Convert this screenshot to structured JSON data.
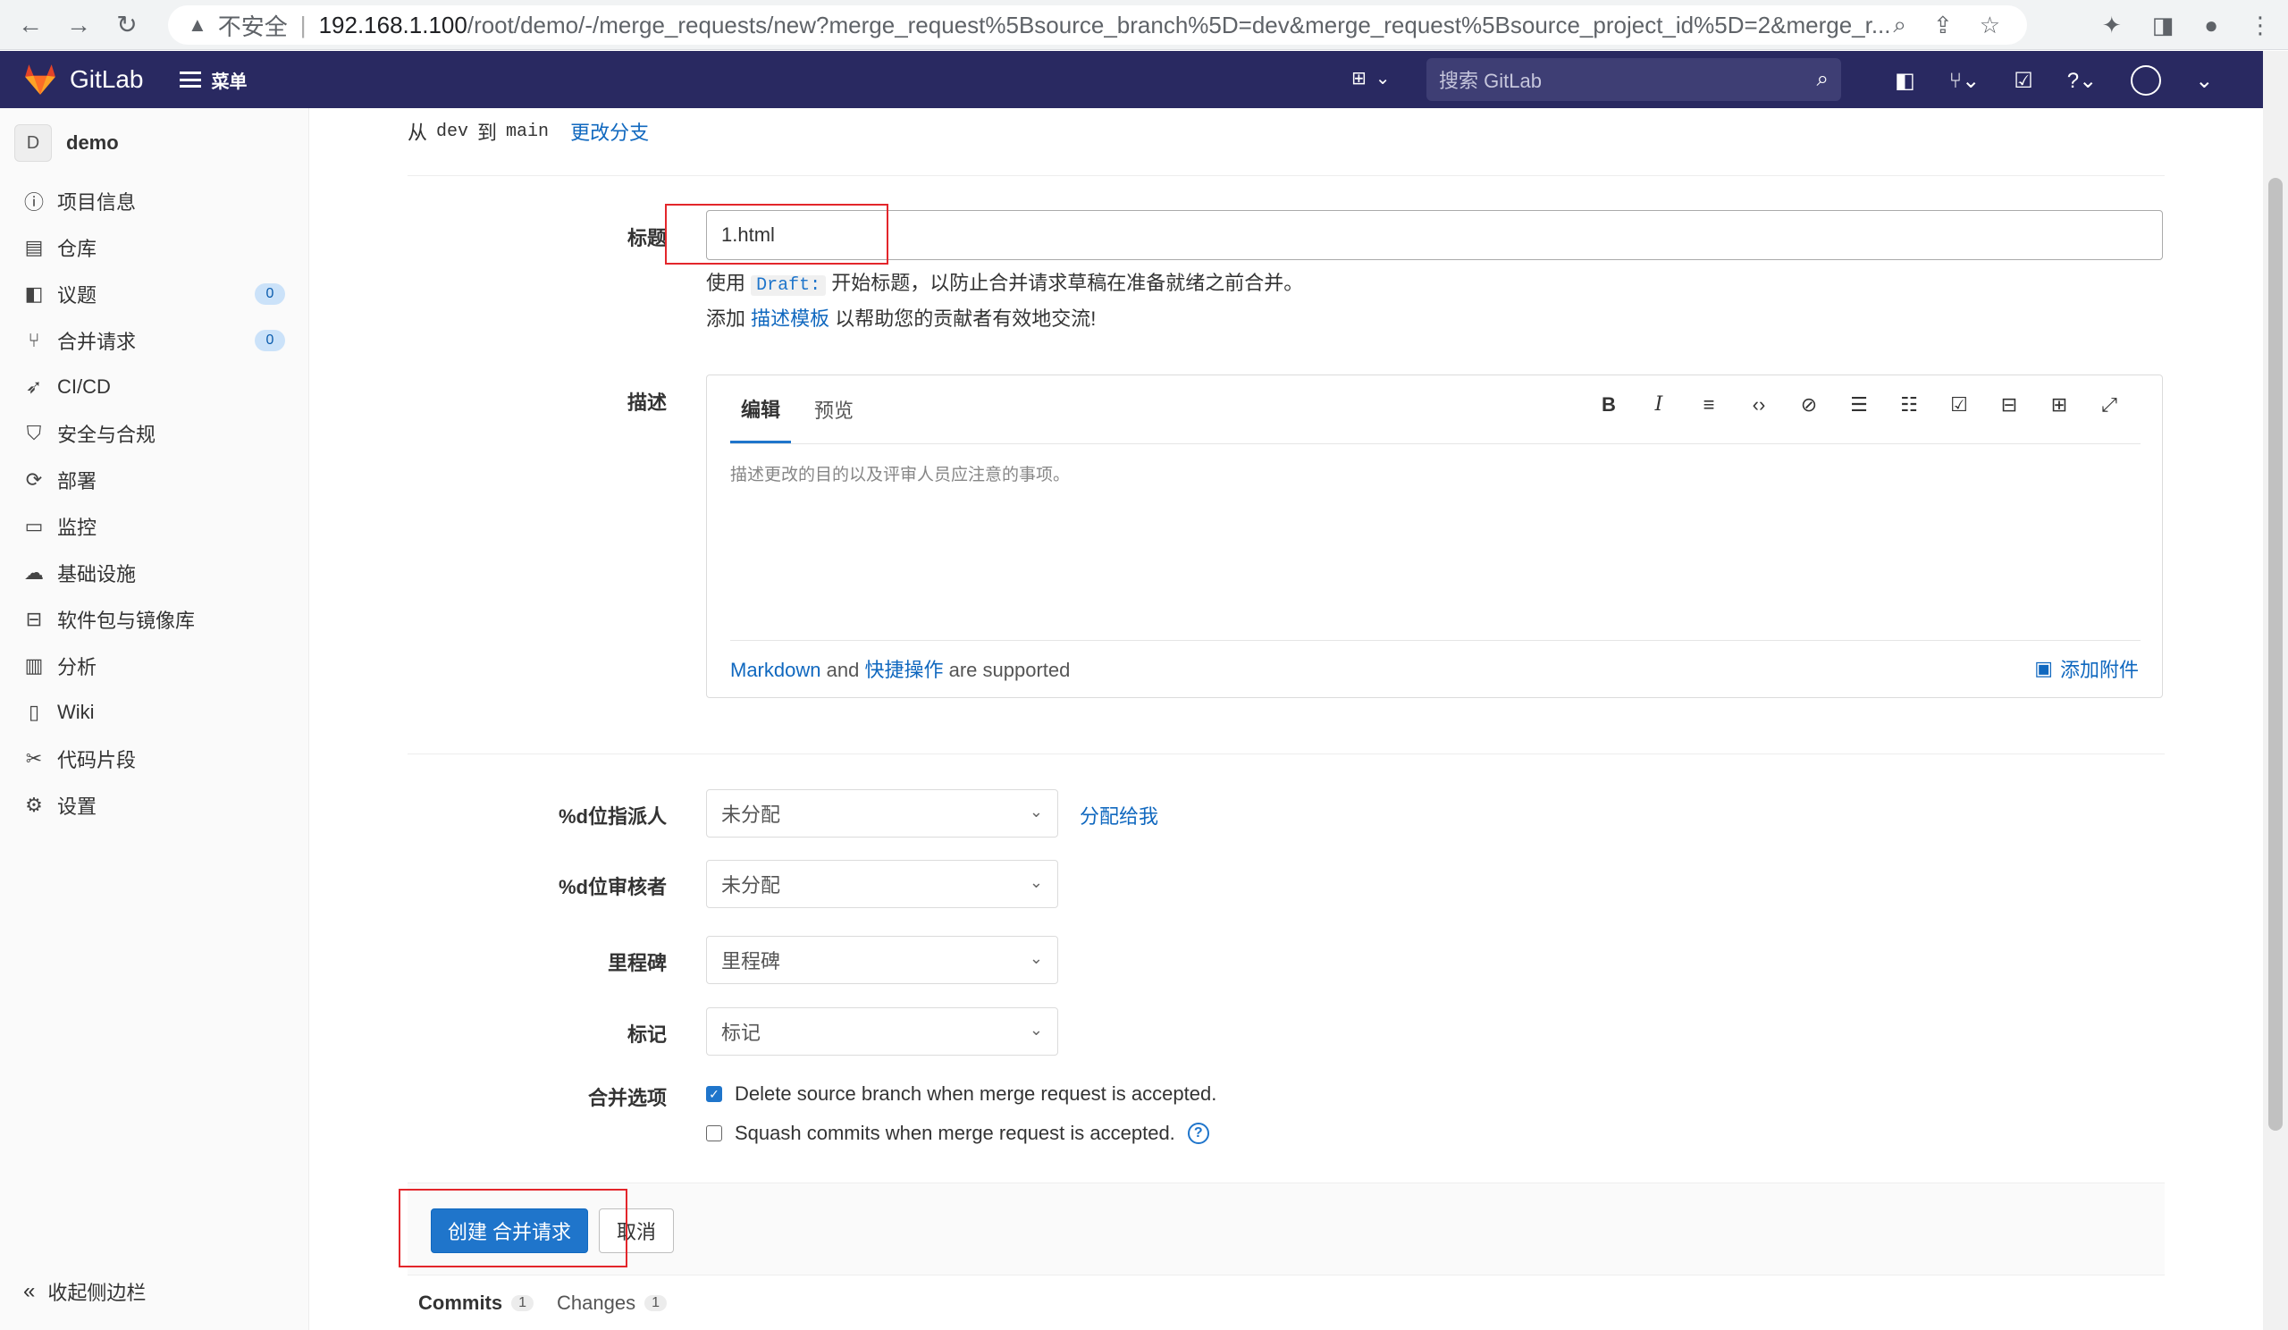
{
  "browser": {
    "back_icon": "←",
    "forward_icon": "→",
    "reload_icon": "↻",
    "insecure_label": "不安全",
    "url_host": "192.168.1.100",
    "url_path": "/root/demo/-/merge_requests/new?merge_request%5Bsource_branch%5D=dev&merge_request%5Bsource_project_id%5D=2&merge_r..."
  },
  "topbar": {
    "logo_text": "GitLab",
    "menu_label": "菜单",
    "search_placeholder": "搜索 GitLab"
  },
  "sidebar": {
    "project_initial": "D",
    "project_name": "demo",
    "items": [
      {
        "label": "项目信息",
        "icon": "info-icon",
        "glyph": "ⓘ"
      },
      {
        "label": "仓库",
        "icon": "doc-icon",
        "glyph": "▤"
      },
      {
        "label": "议题",
        "icon": "issues-icon",
        "glyph": "◧",
        "badge": "0"
      },
      {
        "label": "合并请求",
        "icon": "merge-icon",
        "glyph": "⑂",
        "badge": "0"
      },
      {
        "label": "CI/CD",
        "icon": "rocket-icon",
        "glyph": "➶"
      },
      {
        "label": "安全与合规",
        "icon": "shield-icon",
        "glyph": "⛉"
      },
      {
        "label": "部署",
        "icon": "deploy-icon",
        "glyph": "⟳"
      },
      {
        "label": "监控",
        "icon": "monitor-icon",
        "glyph": "▭"
      },
      {
        "label": "基础设施",
        "icon": "cloud-icon",
        "glyph": "☁"
      },
      {
        "label": "软件包与镜像库",
        "icon": "package-icon",
        "glyph": "⊟"
      },
      {
        "label": "分析",
        "icon": "chart-icon",
        "glyph": "▥"
      },
      {
        "label": "Wiki",
        "icon": "book-icon",
        "glyph": "▯"
      },
      {
        "label": "代码片段",
        "icon": "scissors-icon",
        "glyph": "✂"
      },
      {
        "label": "设置",
        "icon": "gear-icon",
        "glyph": "⚙"
      }
    ],
    "collapse_label": "收起侧边栏"
  },
  "main": {
    "branch_from": "从",
    "source_branch": "dev",
    "branch_to": "到",
    "target_branch": "main",
    "change_branch_link": "更改分支",
    "title_label": "标题",
    "title_value": "1.html",
    "hint_prefix": "使用",
    "hint_code": "Draft:",
    "hint_suffix": "开始标题，以防止合并请求草稿在准备就绪之前合并。",
    "template_prefix": "添加",
    "template_link": "描述模板",
    "template_suffix": "以帮助您的贡献者有效地交流!",
    "description_label": "描述",
    "tab_edit": "编辑",
    "tab_preview": "预览",
    "description_placeholder": "描述更改的目的以及评审人员应注意的事项。",
    "markdown_link": "Markdown",
    "and_text": "and",
    "quick_actions_link": "快捷操作",
    "supported_text": "are supported",
    "attach_label": "添加附件",
    "assignee_label": "%d位指派人",
    "assignee_value": "未分配",
    "assign_to_me": "分配给我",
    "reviewer_label": "%d位审核者",
    "reviewer_value": "未分配",
    "milestone_label": "里程碑",
    "milestone_value": "里程碑",
    "labels_label": "标记",
    "labels_value": "标记",
    "merge_options_label": "合并选项",
    "delete_branch_text": "Delete source branch when merge request is accepted.",
    "delete_branch_checked": true,
    "squash_text": "Squash commits when merge request is accepted.",
    "squash_checked": false,
    "submit_button": "创建 合并请求",
    "cancel_button": "取消",
    "tabs": [
      {
        "label": "Commits",
        "count": "1"
      },
      {
        "label": "Changes",
        "count": "1"
      }
    ]
  },
  "colors": {
    "topbar": "#292961",
    "primary": "#1f75cb",
    "annotation": "#e3262b"
  }
}
